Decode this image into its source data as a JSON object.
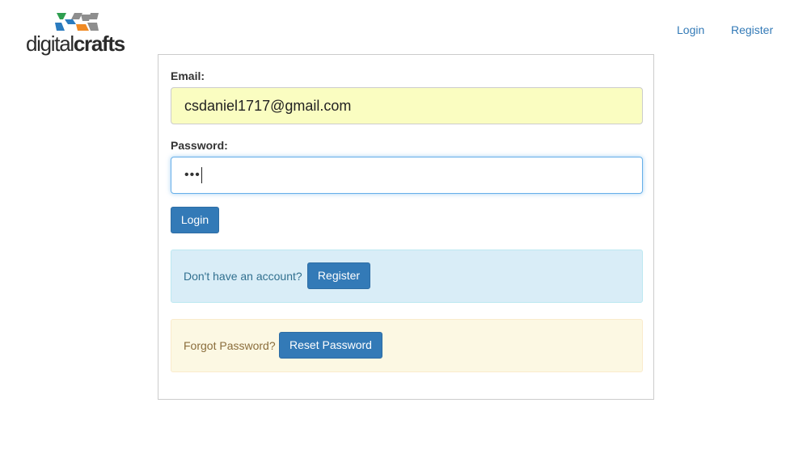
{
  "brand": {
    "logo_text_regular": "digital",
    "logo_text_bold": "crafts",
    "logo_colors": [
      "#2e9e4f",
      "#2a7bbf",
      "#f08a24",
      "#8e8e8e"
    ]
  },
  "nav": {
    "login": "Login",
    "register": "Register"
  },
  "form": {
    "email_label": "Email:",
    "email_value": "csdaniel1717@gmail.com",
    "password_label": "Password:",
    "password_masked": "•••",
    "login_button": "Login"
  },
  "register_panel": {
    "text": "Don't have an account?",
    "button": "Register"
  },
  "reset_panel": {
    "text": "Forgot Password?",
    "button": "Reset Password"
  },
  "colors": {
    "primary": "#337ab7",
    "info_bg": "#d9edf7",
    "warning_bg": "#fcf8e3",
    "autofill_bg": "#fafdc1"
  }
}
